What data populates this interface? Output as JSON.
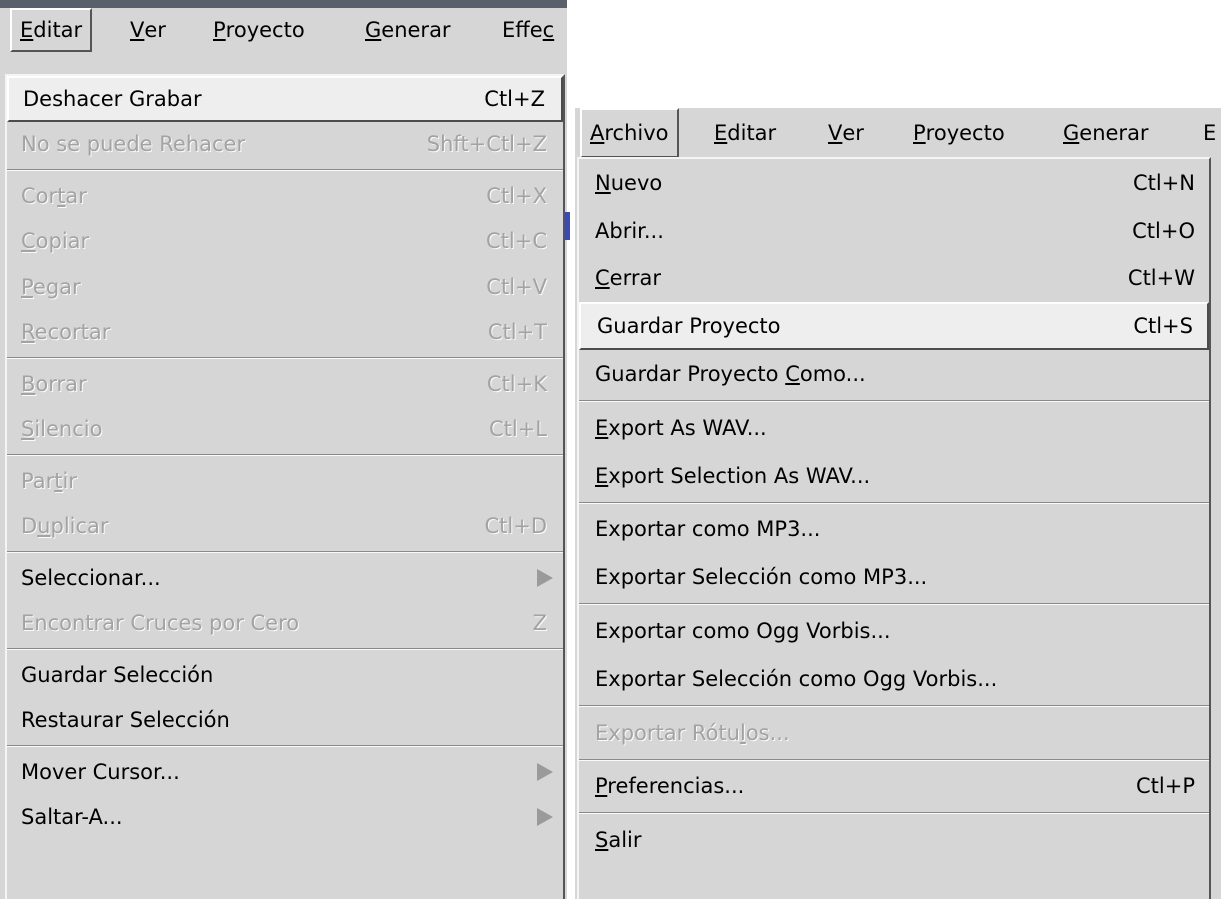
{
  "left_window": {
    "menubar": [
      {
        "pre": "",
        "mn": "E",
        "post": "ditar",
        "open": true
      },
      {
        "pre": "",
        "mn": "V",
        "post": "er",
        "open": false
      },
      {
        "pre": "",
        "mn": "P",
        "post": "royecto",
        "open": false
      },
      {
        "pre": "",
        "mn": "G",
        "post": "enerar",
        "open": false
      },
      {
        "pre": "Effe",
        "mn": "c",
        "post": "",
        "open": false
      }
    ],
    "menu": [
      {
        "pre": "Deshacer Grabar",
        "mn": "",
        "post": "",
        "shortcut": "Ctl+Z",
        "state": "highlighted"
      },
      {
        "pre": "No se puede Rehacer",
        "mn": "",
        "post": "",
        "shortcut": "Shft+Ctl+Z",
        "state": "disabled"
      },
      {
        "sep": true
      },
      {
        "pre": "Cor",
        "mn": "t",
        "post": "ar",
        "shortcut": "Ctl+X",
        "state": "disabled"
      },
      {
        "pre": "",
        "mn": "C",
        "post": "opiar",
        "shortcut": "Ctl+C",
        "state": "disabled"
      },
      {
        "pre": "",
        "mn": "P",
        "post": "egar",
        "shortcut": "Ctl+V",
        "state": "disabled"
      },
      {
        "pre": "",
        "mn": "R",
        "post": "ecortar",
        "shortcut": "Ctl+T",
        "state": "disabled"
      },
      {
        "sep": true
      },
      {
        "pre": "",
        "mn": "B",
        "post": "orrar",
        "shortcut": "Ctl+K",
        "state": "disabled"
      },
      {
        "pre": "",
        "mn": "S",
        "post": "ilencio",
        "shortcut": "Ctl+L",
        "state": "disabled"
      },
      {
        "sep": true
      },
      {
        "pre": "Par",
        "mn": "t",
        "post": "ir",
        "shortcut": "",
        "state": "disabled"
      },
      {
        "pre": "D",
        "mn": "u",
        "post": "plicar",
        "shortcut": "Ctl+D",
        "state": "disabled"
      },
      {
        "sep": true
      },
      {
        "pre": "Seleccionar...",
        "mn": "",
        "post": "",
        "shortcut": "",
        "submenu": true,
        "state": "normal"
      },
      {
        "pre": "Encontrar Cruces por Cero",
        "mn": "",
        "post": "",
        "shortcut": "Z",
        "state": "disabled"
      },
      {
        "sep": true
      },
      {
        "pre": "Guardar Selección",
        "mn": "",
        "post": "",
        "shortcut": "",
        "state": "normal"
      },
      {
        "pre": "Restaurar Selección",
        "mn": "",
        "post": "",
        "shortcut": "",
        "state": "normal"
      },
      {
        "sep": true
      },
      {
        "pre": "Mover Cursor...",
        "mn": "",
        "post": "",
        "shortcut": "",
        "submenu": true,
        "state": "normal"
      },
      {
        "pre": "Saltar-A...",
        "mn": "",
        "post": "",
        "shortcut": "",
        "submenu": true,
        "state": "normal"
      }
    ]
  },
  "right_window": {
    "menubar": [
      {
        "pre": "",
        "mn": "A",
        "post": "rchivo",
        "open": true
      },
      {
        "pre": "",
        "mn": "E",
        "post": "ditar",
        "open": false
      },
      {
        "pre": "",
        "mn": "V",
        "post": "er",
        "open": false
      },
      {
        "pre": "",
        "mn": "P",
        "post": "royecto",
        "open": false
      },
      {
        "pre": "",
        "mn": "G",
        "post": "enerar",
        "open": false
      },
      {
        "pre": "E",
        "mn": "",
        "post": "",
        "open": false
      }
    ],
    "menu": [
      {
        "pre": "",
        "mn": "N",
        "post": "uevo",
        "shortcut": "Ctl+N",
        "state": "normal"
      },
      {
        "pre": "Abrir...",
        "mn": "",
        "post": "",
        "shortcut": "Ctl+O",
        "state": "normal"
      },
      {
        "pre": "",
        "mn": "C",
        "post": "errar",
        "shortcut": "Ctl+W",
        "state": "normal"
      },
      {
        "pre": "Guardar Proyecto",
        "mn": "",
        "post": "",
        "shortcut": "Ctl+S",
        "state": "highlighted"
      },
      {
        "pre": "Guardar  Proyecto ",
        "mn": "C",
        "post": "omo...",
        "shortcut": "",
        "state": "normal"
      },
      {
        "sep": true
      },
      {
        "pre": "",
        "mn": "E",
        "post": "xport As WAV...",
        "shortcut": "",
        "state": "normal"
      },
      {
        "pre": "",
        "mn": "E",
        "post": "xport Selection As WAV...",
        "shortcut": "",
        "state": "normal"
      },
      {
        "sep": true
      },
      {
        "pre": "Exportar como MP3...",
        "mn": "",
        "post": "",
        "shortcut": "",
        "state": "normal"
      },
      {
        "pre": "Exportar Selección como MP3...",
        "mn": "",
        "post": "",
        "shortcut": "",
        "state": "normal"
      },
      {
        "sep": true
      },
      {
        "pre": "Exportar como Ogg Vorbis...",
        "mn": "",
        "post": "",
        "shortcut": "",
        "state": "normal"
      },
      {
        "pre": "Exportar Selección como Ogg Vorbis...",
        "mn": "",
        "post": "",
        "shortcut": "",
        "state": "normal"
      },
      {
        "sep": true
      },
      {
        "pre": "Exportar Rótu",
        "mn": "l",
        "post": "os...",
        "shortcut": "",
        "state": "disabled"
      },
      {
        "sep": true
      },
      {
        "pre": "",
        "mn": "P",
        "post": "referencias...",
        "shortcut": "Ctl+P",
        "state": "normal"
      },
      {
        "sep": true
      },
      {
        "pre": "",
        "mn": "S",
        "post": "alir",
        "shortcut": "",
        "state": "normal"
      }
    ]
  }
}
